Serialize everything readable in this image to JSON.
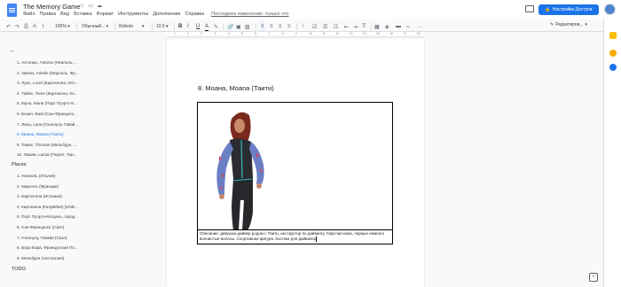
{
  "header": {
    "doc_title": "The Memory Game",
    "menu": [
      "Файл",
      "Правка",
      "Вид",
      "Вставка",
      "Формат",
      "Инструменты",
      "Дополнения",
      "Справка"
    ],
    "last_edit": "Последнее изменение: только что",
    "share_label": "Настройки Доступа"
  },
  "toolbar": {
    "zoom": "100%",
    "style": "Обычный...",
    "font": "Roboto",
    "size": "10.5",
    "edit_mode": "Редактиров..."
  },
  "ruler": {
    "marks": [
      "1",
      "1",
      "2",
      "3",
      "4",
      "5",
      "6",
      "7",
      "8",
      "9",
      "10",
      "11",
      "12",
      "13",
      "14",
      "15",
      "16",
      "17",
      "18"
    ]
  },
  "outline": {
    "characters": [
      "1. Антонио, Antonio (Неаполь, ...",
      "2. Амели, Amelie (Марсель, Фр...",
      "3. Луис, Louis (Барселона, Исп...",
      "4. Тайне, Tiene (Картахена, Ко...",
      "5. Муна, Muna (Порт Пуэрто-К...",
      "6. Базил, Basil (Сан-Франциск...",
      "7. Лана, Lana (Гонолулу, Гавай...",
      "8. Моана, Moana (Таити)",
      "9. Томас, Thomas (Мельбурн, ...",
      "10. Ламаи, Lamai (Пхукет, Таи..."
    ],
    "active_index": 7,
    "places_heading": "Places",
    "places": [
      "1. Неаполь (Италия)",
      "2. Марсель (Франция)",
      "3. Барселона (Испания)",
      "4. Картахена (Колумбия) [UND...",
      "5. Порт Пуэрто-Кетцаль, город...",
      "6. Сан-Франциско (США)",
      "7. Гонолулу, Гавайи (США)",
      "8. Бора Бора, Французская По...",
      "9. Мельбурн (Австралия)"
    ],
    "todo_heading": "TODO"
  },
  "document": {
    "heading": "8. Моана, Moana (Таити)",
    "caption": "Описание: девушка-дайвер родом с Таити, инструктор по дайвингу. Смуглая кожа, черные немного волнистые волосы. Спортивная фигура. Костюм для дайвинга"
  },
  "colors": {
    "accent": "#1a73e8",
    "active_outline": "#1a73e8"
  }
}
